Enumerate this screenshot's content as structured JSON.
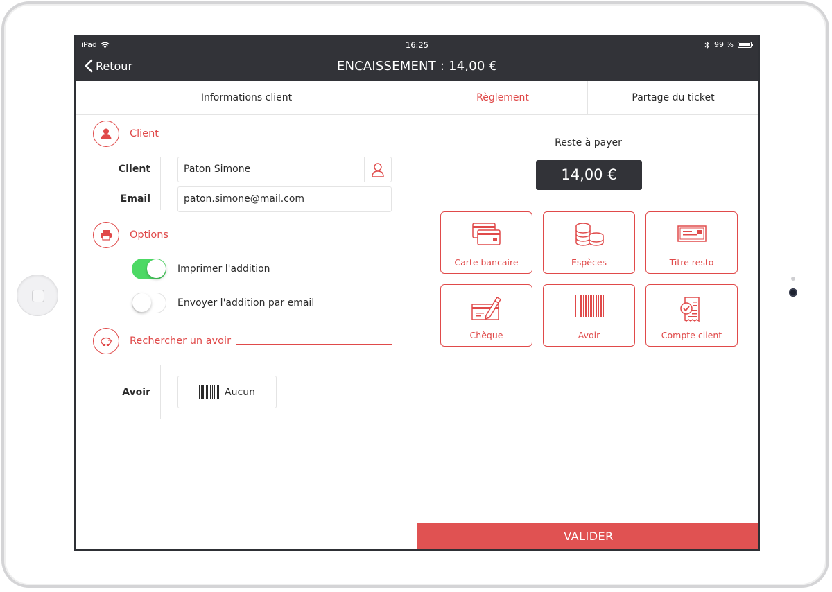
{
  "status_bar": {
    "device": "iPad",
    "time": "16:25",
    "battery": "99 %"
  },
  "nav": {
    "back_label": "Retour",
    "title": "ENCAISSEMENT : 14,00 €"
  },
  "tabs": [
    {
      "label": "Informations client",
      "active": false
    },
    {
      "label": "Règlement",
      "active": true
    },
    {
      "label": "Partage du ticket",
      "active": false
    }
  ],
  "client_section": {
    "heading": "Client",
    "client_label": "Client",
    "client_value": "Paton Simone",
    "email_label": "Email",
    "email_value": "paton.simone@mail.com"
  },
  "options_section": {
    "heading": "Options",
    "print_label": "Imprimer l'addition",
    "print_on": true,
    "email_label": "Envoyer l'addition par email",
    "email_on": false
  },
  "avoir_section": {
    "heading": "Rechercher un avoir",
    "avoir_label": "Avoir",
    "avoir_value": "Aucun"
  },
  "payment": {
    "remaining_label": "Reste à payer",
    "remaining_amount": "14,00 €",
    "methods": [
      {
        "label": "Carte bancaire",
        "icon": "credit-card-icon"
      },
      {
        "label": "Espèces",
        "icon": "coins-icon"
      },
      {
        "label": "Titre resto",
        "icon": "voucher-icon"
      },
      {
        "label": "Chèque",
        "icon": "cheque-icon"
      },
      {
        "label": "Avoir",
        "icon": "barcode-icon"
      },
      {
        "label": "Compte client",
        "icon": "client-account-icon"
      }
    ],
    "submit_label": "VALIDER"
  },
  "colors": {
    "accent": "#e04a4a",
    "dark": "#323338",
    "toggle_on": "#4cd964",
    "submit": "#e05252"
  }
}
